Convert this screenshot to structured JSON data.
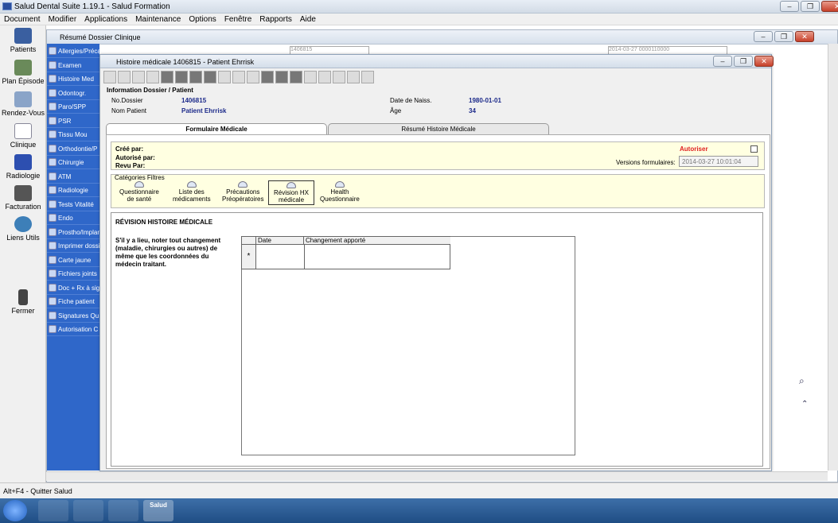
{
  "app": {
    "title": "Salud Dental Suite 1.19.1 - Salud Formation"
  },
  "menu": [
    "Document",
    "Modifier",
    "Applications",
    "Maintenance",
    "Options",
    "Fenêtre",
    "Rapports",
    "Aide"
  ],
  "left_nav": [
    {
      "label": "Patients",
      "icon": "patients-icon"
    },
    {
      "label": "Plan Épisode",
      "icon": "plan-icon"
    },
    {
      "label": "Rendez-Vous",
      "icon": "calendar-icon"
    },
    {
      "label": "Clinique",
      "icon": "tooth-icon"
    },
    {
      "label": "Radiologie",
      "icon": "xray-icon"
    },
    {
      "label": "Facturation",
      "icon": "invoice-icon"
    },
    {
      "label": "Liens Utils",
      "icon": "globe-icon"
    },
    {
      "label": "Fermer",
      "icon": "exit-icon"
    }
  ],
  "sidebar": [
    "Allergies/Précautions médic",
    "Examen",
    "Histoire Med",
    "Odontogr.",
    "Paro/SPP",
    "PSR",
    "Tissu Mou",
    "Orthodontie/P",
    "Chirurgie",
    "ATM",
    "Radiologie",
    "Tests Vitalité",
    "Endo",
    "Prostho/Implan",
    "Imprimer dossier",
    "Carte jaune",
    "Fichiers joints",
    "Doc + Rx à sig",
    "Fiche patient",
    "Signatures Qu",
    "Autorisation C"
  ],
  "bg_window": {
    "title": "Résumé Dossier Clinique",
    "field1": "1406815",
    "field2": "2014-03-27 0000110000"
  },
  "window": {
    "title": "Histoire médicale 1406815 - Patient Ehrrisk"
  },
  "info": {
    "section": "Information Dossier / Patient",
    "dossier_label": "No.Dossier",
    "dossier_value": "1406815",
    "name_label": "Nom Patient",
    "name_value": "Patient Ehrrisk",
    "dob_label": "Date de Naiss.",
    "dob_value": "1980-01-01",
    "age_label": "Âge",
    "age_value": "34"
  },
  "tabs": {
    "form": "Formulaire Médicale",
    "summary": "Résumé Histoire Médicale"
  },
  "form": {
    "created_by": "Créé par:",
    "authorized_by": "Autorisé par:",
    "reviewed_by": "Revu Par:",
    "authorize": "Autoriser",
    "versions_label": "Versions formulaires:",
    "versions_value": "2014-03-27 10:01:04",
    "filters_label": "Catégories Filtres",
    "filters": [
      [
        "Questionnaire",
        "de santé"
      ],
      [
        "Liste des",
        "médicaments"
      ],
      [
        "Précautions",
        "Préopératoires"
      ],
      [
        "Révision HX",
        "médicale"
      ],
      [
        "Health",
        "Questionnaire"
      ]
    ]
  },
  "content": {
    "heading": "RÉVISION HISTOIRE MÉDICALE",
    "instructions": "S'il y a lieu, noter tout changement (maladie, chirurgies ou autres) de même que les coordonnées du médecin traitant.",
    "col_date": "Date",
    "col_change": "Changement apporté",
    "new_row_marker": "*"
  },
  "status": {
    "text": "Alt+F4 - Quitter Salud"
  },
  "taskbar": {
    "salud": "Salud"
  }
}
